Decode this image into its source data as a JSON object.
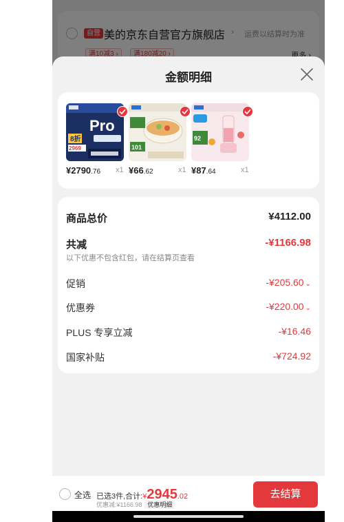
{
  "background_store": {
    "badge": "自营",
    "name": "美的京东自营官方旗舰店",
    "arrow": "›",
    "shipping_note": "运费以结算时为准",
    "coupons": [
      "满10减3 ›",
      "满180减20 ›"
    ],
    "more": "更多 ›"
  },
  "sheet": {
    "title": "金额明细",
    "close_icon": "close-icon"
  },
  "products": [
    {
      "name": "air-conditioner-product",
      "price_int": "¥2790",
      "price_dec": ".76",
      "qty": "x1",
      "selected": true
    },
    {
      "name": "electric-hotpot-product",
      "price_int": "¥66",
      "price_dec": ".62",
      "qty": "x1",
      "selected": true
    },
    {
      "name": "blender-product",
      "price_int": "¥87",
      "price_dec": ".64",
      "qty": "x1",
      "selected": true
    }
  ],
  "details": {
    "subtotal_label": "商品总价",
    "subtotal_value": "¥4112.00",
    "total_discount_label": "共减",
    "total_discount_value": "-¥1166.98",
    "discount_note": "以下优惠不包含红包，请在结算页查看",
    "promotion_label": "促销",
    "promotion_value": "-¥205.60",
    "coupon_label": "优惠券",
    "coupon_value": "-¥220.00",
    "plus_label": "PLUS 专享立减",
    "plus_value": "-¥16.46",
    "subsidy_label": "国家补贴",
    "subsidy_value": "-¥724.92"
  },
  "bottom_bar": {
    "select_all": "全选",
    "summary_prefix": "已选3件,合计:",
    "total_yen": "¥",
    "total_int": "2945",
    "total_dec": ".02",
    "discount_text": "优惠减:¥1166.98",
    "discount_detail": "优惠明细",
    "checkout": "去结算"
  },
  "colors": {
    "accent": "#e4393c"
  }
}
